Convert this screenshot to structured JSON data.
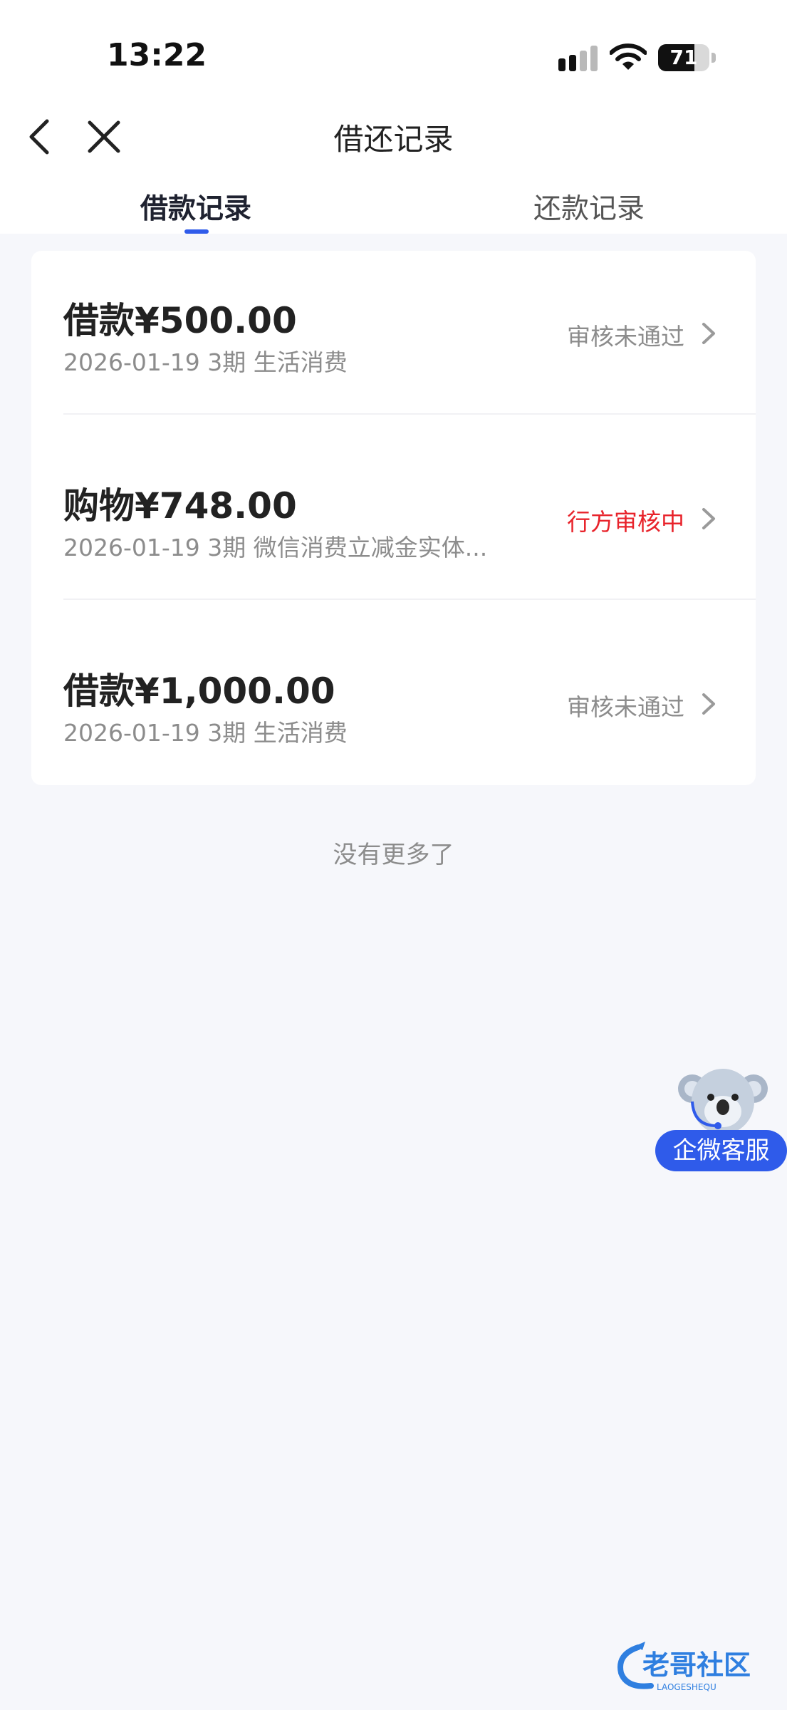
{
  "status_bar": {
    "time": "13:22",
    "battery": "71"
  },
  "nav": {
    "title": "借还记录"
  },
  "tabs": [
    {
      "label": "借款记录",
      "active": true
    },
    {
      "label": "还款记录",
      "active": false
    }
  ],
  "records": [
    {
      "amount": "借款¥500.00",
      "meta": "2026-01-19 3期  生活消费",
      "status": "审核未通过",
      "status_color": "#8c8c8c"
    },
    {
      "amount": "购物¥748.00",
      "meta": "2026-01-19 3期  微信消费立减金实体...",
      "status": "行方审核中",
      "status_color": "#e8232b"
    },
    {
      "amount": "借款¥1,000.00",
      "meta": "2026-01-19 3期  生活消费",
      "status": "审核未通过",
      "status_color": "#8c8c8c"
    }
  ],
  "footer": {
    "no_more": "没有更多了"
  },
  "customer_service": {
    "label": "企微客服"
  },
  "watermark": {
    "text": "老哥社区",
    "subtext": "LAOGESHEQU"
  },
  "colors": {
    "accent": "#2f5bea",
    "status_pending": "#e8232b",
    "status_rejected": "#8c8c8c",
    "page_background": "#f6f7fb"
  },
  "icons": [
    "back-icon",
    "close-icon",
    "chevron-right-icon",
    "signal-icon",
    "wifi-icon",
    "battery-icon",
    "koala-mascot-icon"
  ]
}
